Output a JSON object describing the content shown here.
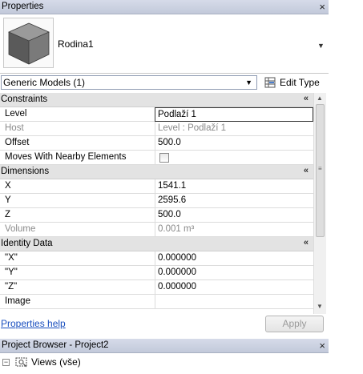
{
  "properties_panel": {
    "title": "Properties",
    "type_name": "Rodina1",
    "selector_value": "Generic Models (1)",
    "edit_type_label": "Edit Type",
    "help_link": "Properties help",
    "apply_label": "Apply"
  },
  "groups": {
    "constraints": "Constraints",
    "dimensions": "Dimensions",
    "identity": "Identity Data"
  },
  "params": {
    "level": {
      "name": "Level",
      "value": "Podlaží 1"
    },
    "host": {
      "name": "Host",
      "value": "Level : Podlaží 1"
    },
    "offset": {
      "name": "Offset",
      "value": "500.0"
    },
    "moves": {
      "name": "Moves With Nearby Elements",
      "checked": false
    },
    "x": {
      "name": "X",
      "value": "1541.1"
    },
    "y": {
      "name": "Y",
      "value": "2595.6"
    },
    "z": {
      "name": "Z",
      "value": "500.0"
    },
    "volume": {
      "name": "Volume",
      "value": "0.001 m³"
    },
    "qx": {
      "name": "\"X\"",
      "value": "0.000000"
    },
    "qy": {
      "name": "\"Y\"",
      "value": "0.000000"
    },
    "qz": {
      "name": "\"Z\"",
      "value": "0.000000"
    },
    "image": {
      "name": "Image",
      "value": ""
    }
  },
  "project_browser": {
    "title": "Project Browser - Project2",
    "root_label": "Views (vše)"
  },
  "colors": {
    "title_bar": "#c9cfdf",
    "group_header": "#e3e3e3",
    "link": "#1a4fbf"
  }
}
